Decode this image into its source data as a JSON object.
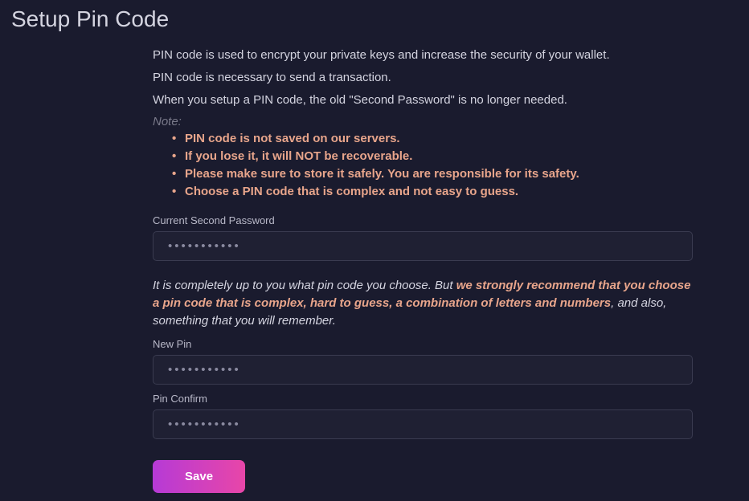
{
  "page": {
    "title": "Setup Pin Code"
  },
  "intro": {
    "line1": "PIN code is used to encrypt your private keys and increase the security of your wallet.",
    "line2": "PIN code is necessary to send a transaction.",
    "line3": "When you setup a PIN code, the old \"Second Password\" is no longer needed."
  },
  "note": {
    "label": "Note:",
    "items": [
      "PIN code is not saved on our servers.",
      "If you lose it, it will NOT be recoverable.",
      "Please make sure to store it safely. You are responsible for its safety.",
      "Choose a PIN code that is complex and not easy to guess."
    ]
  },
  "fields": {
    "current_password": {
      "label": "Current Second Password",
      "placeholder": "•••••••••••",
      "value": ""
    },
    "new_pin": {
      "label": "New Pin",
      "placeholder": "•••••••••••",
      "value": ""
    },
    "pin_confirm": {
      "label": "Pin Confirm",
      "placeholder": "•••••••••••",
      "value": ""
    }
  },
  "recommend": {
    "part1": "It is completely up to you what pin code you choose. But ",
    "strong": "we strongly recommend that you choose a pin code that is complex, hard to guess, a combination of letters and numbers",
    "part2": ", and also, something that you will remember."
  },
  "buttons": {
    "save_label": "Save"
  }
}
